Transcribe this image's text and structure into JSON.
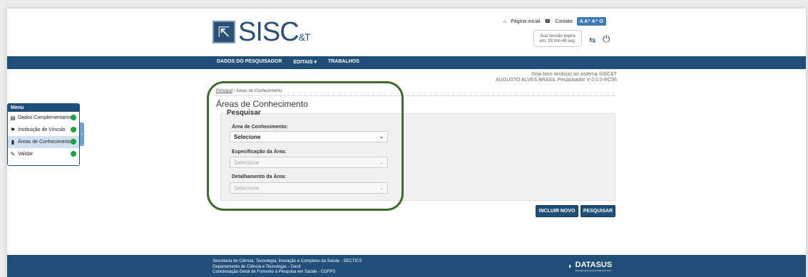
{
  "header": {
    "logo_text": "SISC",
    "logo_suffix": "&T",
    "home_link": "Página inicial",
    "contact_link": "Contato",
    "accessibility": [
      "A",
      "A⁺",
      "A⁺",
      "O"
    ],
    "session_line1": "Sua sessão expira",
    "session_line2": "em: 29 min 49 seg."
  },
  "nav": {
    "items": [
      "DADOS DO PESQUISADOR",
      "EDITAIS ▾",
      "TRABALHOS"
    ]
  },
  "welcome": {
    "line1": "Seja bem vindo(a) ao sistema SISC&T",
    "line2": "AUGUSTO ALVES BRASIL Pesquisador V-2.0.0-RC56"
  },
  "breadcrumb": {
    "home": "Principal",
    "separator": " / ",
    "current": "Áreas de Conhecimento"
  },
  "page_title": "Áreas de Conhecimento",
  "search": {
    "legend": "Pesquisar",
    "fields": [
      {
        "label": "Área de Conhecimento:",
        "value": "Selecione"
      },
      {
        "label": "Especificação da Área:",
        "value": "Selecione"
      },
      {
        "label": "Detalhamento da Área:",
        "value": "Selecione"
      }
    ]
  },
  "buttons": {
    "new": "INCLUIR NOVO",
    "search": "PESQUISAR"
  },
  "menu": {
    "title": "Menu",
    "items": [
      {
        "label": "Dados Complementares"
      },
      {
        "label": "Instituição de Vínculo"
      },
      {
        "label": "Áreas de Conhecimento"
      },
      {
        "label": "Validar"
      }
    ]
  },
  "footer": {
    "line1": "Secretaria de Ciência, Tecnologia, Inovação e Complexo da Saúde - SECTICS",
    "line2": "Departamento de Ciência e Tecnologia – Decit",
    "line3": "Coordenação Geral de Fomento à Pesquisa em Saúde - CGFPS",
    "logo": "DATASUS",
    "logo_sub": "Departamento de Informática do SUS"
  },
  "colors": {
    "primary": "#1f4e79",
    "status_ok": "#1aa33a",
    "highlight": "#3d6b2a"
  }
}
